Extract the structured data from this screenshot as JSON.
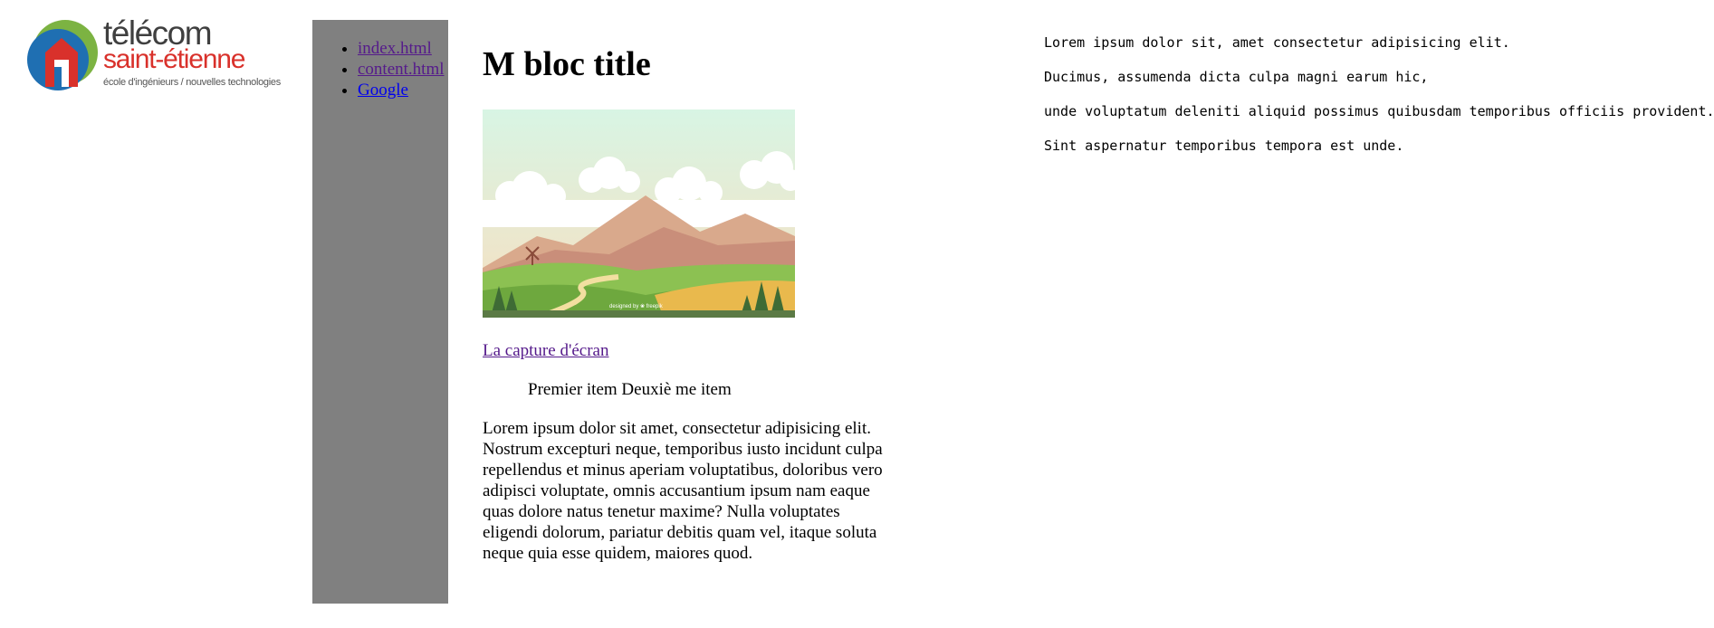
{
  "logo": {
    "word_1": "télécom",
    "word_2": "saint-étienne",
    "tagline": "école d'ingénieurs / nouvelles technologies"
  },
  "nav": {
    "links": [
      {
        "label": "index.html"
      },
      {
        "label": "content.html"
      },
      {
        "label": "Google"
      }
    ]
  },
  "main": {
    "title": "M bloc title",
    "image_credit": "designed by ❀ freepik",
    "capture_link": "La capture d'écran",
    "items_line": "Premier item Deuxiè me item",
    "paragraph": "Lorem ipsum dolor sit amet, consectetur adipisicing elit. Nostrum excepturi neque, temporibus iusto incidunt culpa repellendus et minus aperiam voluptatibus, doloribus vero adipisci voluptate, omnis accusantium ipsum nam eaque quas dolore natus tenetur maxime? Nulla voluptates eligendi dolorum, pariatur debitis quam vel, itaque soluta neque quia esse quidem, maiores quod."
  },
  "aside": {
    "lines": [
      "Lorem ipsum dolor sit, amet consectetur adipisicing elit.",
      "Ducimus, assumenda dicta culpa magni earum hic,",
      "unde voluptatum deleniti aliquid possimus quibusdam temporibus officiis provident.",
      "Sint aspernatur temporibus tempora est unde."
    ]
  },
  "colors": {
    "sidebar_bg": "#808080",
    "visited_link": "#551a8b",
    "unvisited_link": "#0000ee",
    "logo_red": "#d9312b",
    "logo_grey": "#3f3f3f"
  }
}
